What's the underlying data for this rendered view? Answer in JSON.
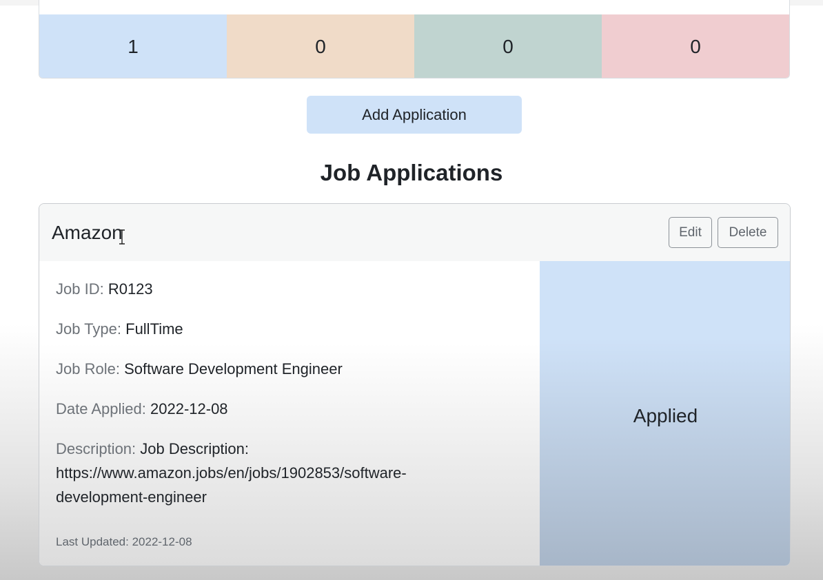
{
  "summary": {
    "counts": [
      {
        "value": "1",
        "color": "#cfe2f8"
      },
      {
        "value": "0",
        "color": "#f0dbc8"
      },
      {
        "value": "0",
        "color": "#c0d4d0"
      },
      {
        "value": "0",
        "color": "#f0cdd0"
      }
    ]
  },
  "actions": {
    "add_label": "Add Application",
    "add_color": "#cfe2f8"
  },
  "section": {
    "title": "Job Applications"
  },
  "application": {
    "company": "Amazon",
    "edit_label": "Edit",
    "delete_label": "Delete",
    "fields": [
      {
        "label": "Job ID:",
        "value": "R0123"
      },
      {
        "label": "Job Type:",
        "value": "FullTime"
      },
      {
        "label": "Job Role:",
        "value": "Software Development Engineer"
      },
      {
        "label": "Date Applied:",
        "value": "2022-12-08"
      },
      {
        "label": "Description:",
        "value": "Job Description: https://www.amazon.jobs/en/jobs/1902853/software-development-engineer"
      }
    ],
    "last_updated": "Last Updated: 2022-12-08",
    "status": "Applied",
    "status_color_top": "#cfe2f8",
    "status_color_bottom": "#a7b6c8"
  }
}
